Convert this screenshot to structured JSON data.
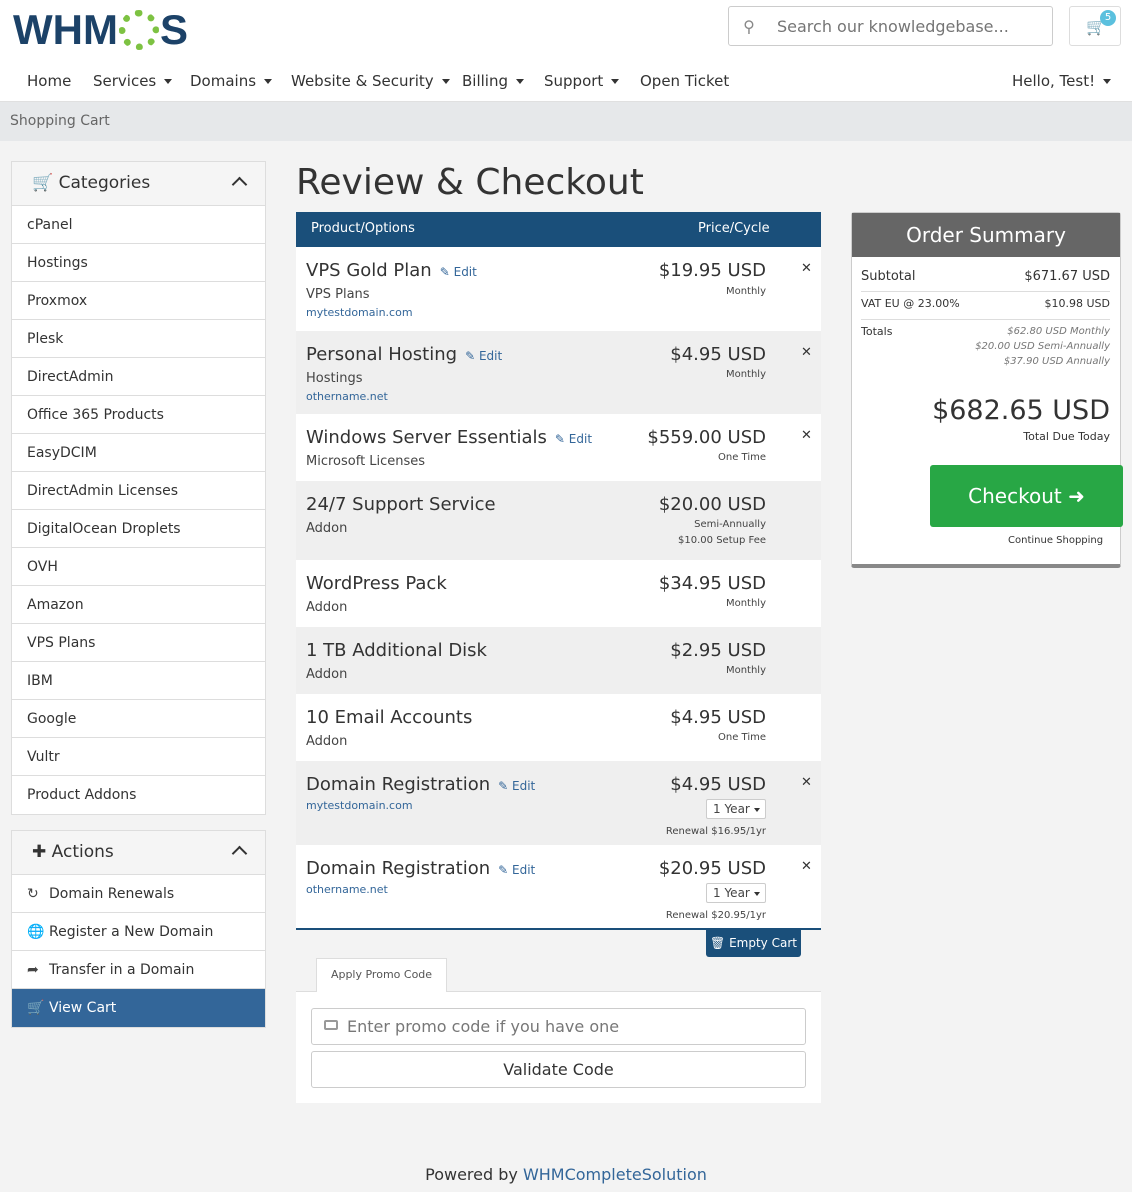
{
  "brand": {
    "logo_pre": "WHM",
    "logo_post": "S"
  },
  "search": {
    "placeholder": "Search our knowledgebase..."
  },
  "cart_count": "5",
  "nav": {
    "home": "Home",
    "services": "Services",
    "domains": "Domains",
    "website_security": "Website & Security",
    "billing": "Billing",
    "support": "Support",
    "open_ticket": "Open Ticket",
    "user": "Hello, Test!"
  },
  "breadcrumb": "Shopping Cart",
  "categories": {
    "title": "Categories",
    "items": [
      "cPanel",
      "Hostings",
      "Proxmox",
      "Plesk",
      "DirectAdmin",
      "Office 365 Products",
      "EasyDCIM",
      "DirectAdmin Licenses",
      "DigitalOcean Droplets",
      "OVH",
      "Amazon",
      "VPS Plans",
      "IBM",
      "Google",
      "Vultr",
      "Product Addons"
    ]
  },
  "actions": {
    "title": "Actions",
    "items": [
      "Domain Renewals",
      "Register a New Domain",
      "Transfer in a Domain",
      "View Cart"
    ]
  },
  "page_title": "Review & Checkout",
  "cart": {
    "col_product": "Product/Options",
    "col_price": "Price/Cycle",
    "edit": "Edit",
    "items": [
      {
        "name": "VPS Gold Plan",
        "group": "VPS Plans",
        "domain": "mytestdomain.com",
        "price": "$19.95 USD",
        "cycle": "Monthly"
      },
      {
        "name": "Personal Hosting",
        "group": "Hostings",
        "domain": "othername.net",
        "price": "$4.95 USD",
        "cycle": "Monthly"
      },
      {
        "name": "Windows Server Essentials",
        "group": "Microsoft Licenses",
        "price": "$559.00 USD",
        "cycle": "One Time"
      },
      {
        "name": "24/7 Support Service",
        "group": "Addon",
        "price": "$20.00 USD",
        "cycle": "Semi-Annually",
        "setup": "$10.00 Setup Fee"
      },
      {
        "name": "WordPress Pack",
        "group": "Addon",
        "price": "$34.95 USD",
        "cycle": "Monthly"
      },
      {
        "name": "1 TB Additional Disk",
        "group": "Addon",
        "price": "$2.95 USD",
        "cycle": "Monthly"
      },
      {
        "name": "10 Email Accounts",
        "group": "Addon",
        "price": "$4.95 USD",
        "cycle": "One Time"
      },
      {
        "name": "Domain Registration",
        "domain": "mytestdomain.com",
        "price": "$4.95 USD",
        "period": "1 Year",
        "renewal": "Renewal $16.95/1yr"
      },
      {
        "name": "Domain Registration",
        "domain": "othername.net",
        "price": "$20.95 USD",
        "period": "1 Year",
        "renewal": "Renewal $20.95/1yr"
      }
    ],
    "empty_cart": "Empty Cart"
  },
  "promo": {
    "tab": "Apply Promo Code",
    "placeholder": "Enter promo code if you have one",
    "validate": "Validate Code"
  },
  "summary": {
    "title": "Order Summary",
    "subtotal_label": "Subtotal",
    "subtotal": "$671.67 USD",
    "vat_label": "VAT EU @ 23.00%",
    "vat": "$10.98 USD",
    "totals_label": "Totals",
    "totals": [
      "$62.80 USD Monthly",
      "$20.00 USD Semi-Annually",
      "$37.90 USD Annually"
    ],
    "total_due": "$682.65 USD",
    "total_due_label": "Total Due Today",
    "checkout": "Checkout",
    "continue": "Continue Shopping"
  },
  "footer": {
    "prefix": "Powered by",
    "link": "WHMCompleteSolution"
  }
}
